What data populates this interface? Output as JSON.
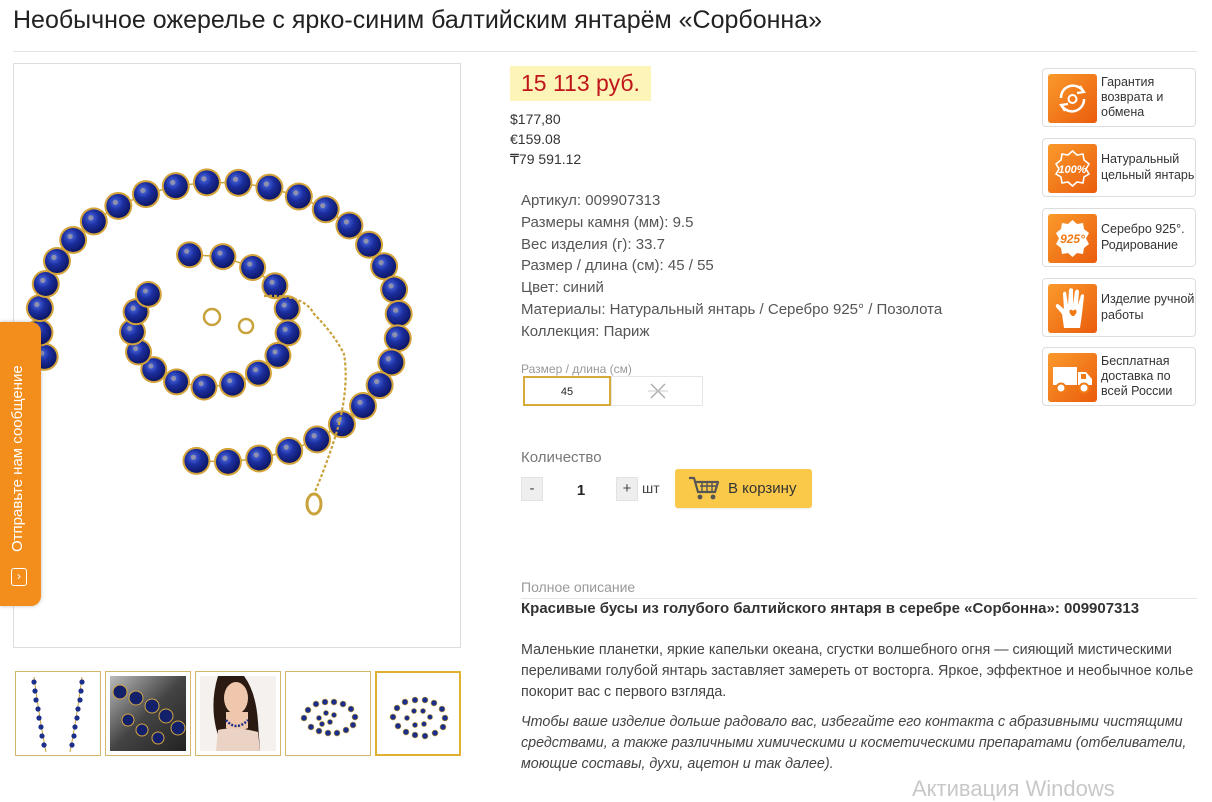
{
  "product": {
    "title": "Необычное ожерелье с ярко-синим балтийским янтарём «Сорбонна»",
    "price": "15 113 руб.",
    "currencies": [
      "$177,80",
      "€159.08",
      "₸79 591.12"
    ]
  },
  "specs": [
    {
      "label": "Артикул:",
      "value": "009907313"
    },
    {
      "label": "Размеры камня (мм):",
      "value": "9.5"
    },
    {
      "label": "Вес изделия (г):",
      "value": "33.7"
    },
    {
      "label": "Размер / длина (см):",
      "value": "45 / 55"
    },
    {
      "label": "Цвет:",
      "value": "синий"
    },
    {
      "label": "Материалы:",
      "value": "Натуральный янтарь / Серебро 925° / Позолота"
    },
    {
      "label": "Коллекция:",
      "value": "Париж"
    }
  ],
  "size_selector": {
    "label": "Размер / длина (см)",
    "selected": "45",
    "unavailable_icon": "cross-icon"
  },
  "quantity": {
    "label": "Количество",
    "minus": "-",
    "value": "1",
    "plus": "+",
    "unit": "шт"
  },
  "cart": {
    "label": "В корзину",
    "icon": "cart-icon"
  },
  "description": {
    "label": "Полное описание",
    "heading": "Красивые бусы из голубого балтийского янтаря в серебре «Сорбонна»: 009907313",
    "paragraph": "Маленькие планетки, яркие капельки океана, сгустки волшебного огня — сияющий мистическими переливами голубой янтарь заставляет замереть от восторга. Яркое, эффектное и необычное колье покорит вас с первого взгляда.",
    "care": "Чтобы ваше изделие дольше радовало вас, избегайте его контакта с абразивными чистящими средствами, а также различными химическими и косметическими препаратами (отбеливатели, моющие составы, духи, ацетон и так далее)."
  },
  "badges": [
    {
      "text": "Гарантия возврата и обмена",
      "icon": "return-exchange-icon"
    },
    {
      "text": "Натуральный цельный янтарь",
      "icon": "natural-amber-icon",
      "icon_text": "100%"
    },
    {
      "text": "Серебро 925°. Родирование",
      "icon": "silver-925-icon",
      "icon_text": "925°"
    },
    {
      "text": "Изделие ручной работы",
      "icon": "handmade-icon"
    },
    {
      "text": "Бесплатная доставка по всей России",
      "icon": "delivery-truck-icon"
    }
  ],
  "feedback_tab": {
    "label": "Отправьте нам сообщение",
    "icon": "chevron-right-icon"
  },
  "thumbnails": [
    "necklace-vertical",
    "beads-closeup",
    "model-wearing",
    "necklace-spiral",
    "necklace-spiral-active"
  ],
  "watermark": "Активация Windows",
  "colors": {
    "price": "#c0161b",
    "price_bg": "#fcf5b7",
    "accent_orange": "#f38d1c",
    "cart_button": "#fbc94a",
    "selected_border": "#d8a93b"
  }
}
